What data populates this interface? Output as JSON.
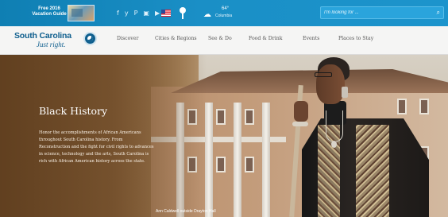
{
  "topbar": {
    "guide_text": "Free 2016 Vacation Guide",
    "social_icons": [
      "facebook-icon",
      "twitter-icon",
      "pinterest-icon",
      "instagram-icon",
      "youtube-icon"
    ],
    "social_glyphs": [
      "f",
      "y",
      "P",
      "▣",
      "▶"
    ],
    "weather_temp": "64°",
    "weather_city": "Columbia",
    "search_placeholder": "I'm looking for ..."
  },
  "nav": {
    "logo_line1": "South Carolina",
    "logo_line2": "Just right.",
    "items": [
      "Discover",
      "Cities & Regions",
      "See & Do",
      "Food & Drink",
      "Events",
      "Places to Stay"
    ]
  },
  "hero": {
    "title": "Black History",
    "body": "Honor the accomplishments of African Americans throughout South Carolina history. From Reconstruction and the fight for civil rights to advances in science, technology and the arts, South Carolina is rich with African American history across the state.",
    "caption": "Ann Caldwell outside Drayton Hall"
  },
  "colors": {
    "topbar": "#1a8fc6",
    "brand": "#0f5f8e",
    "nav_bg": "#f5f5f4"
  }
}
